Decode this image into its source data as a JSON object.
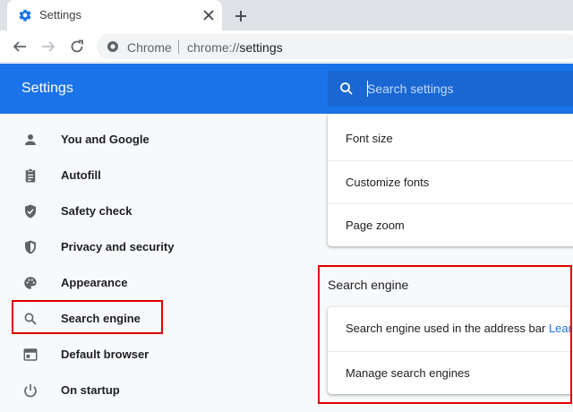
{
  "browser": {
    "tab_title": "Settings",
    "omnibox_site": "Chrome",
    "url_scheme": "chrome://",
    "url_path": "settings"
  },
  "settings": {
    "header_title": "Settings",
    "search_placeholder": "Search settings"
  },
  "sidebar": {
    "items": [
      {
        "label": "You and Google",
        "icon": "person-icon"
      },
      {
        "label": "Autofill",
        "icon": "clipboard-icon"
      },
      {
        "label": "Safety check",
        "icon": "shield-check-icon"
      },
      {
        "label": "Privacy and security",
        "icon": "shield-half-icon"
      },
      {
        "label": "Appearance",
        "icon": "palette-icon"
      },
      {
        "label": "Search engine",
        "icon": "search-icon"
      },
      {
        "label": "Default browser",
        "icon": "browser-window-icon"
      },
      {
        "label": "On startup",
        "icon": "power-icon"
      }
    ]
  },
  "appearance_card": {
    "rows": [
      "Font size",
      "Customize fonts",
      "Page zoom"
    ]
  },
  "search_engine_section": {
    "title": "Search engine",
    "address_bar_label": "Search engine used in the address bar",
    "learn_more": "Learn",
    "manage_label": "Manage search engines"
  },
  "colors": {
    "accent": "#1a73e8",
    "highlight": "#e00000"
  }
}
